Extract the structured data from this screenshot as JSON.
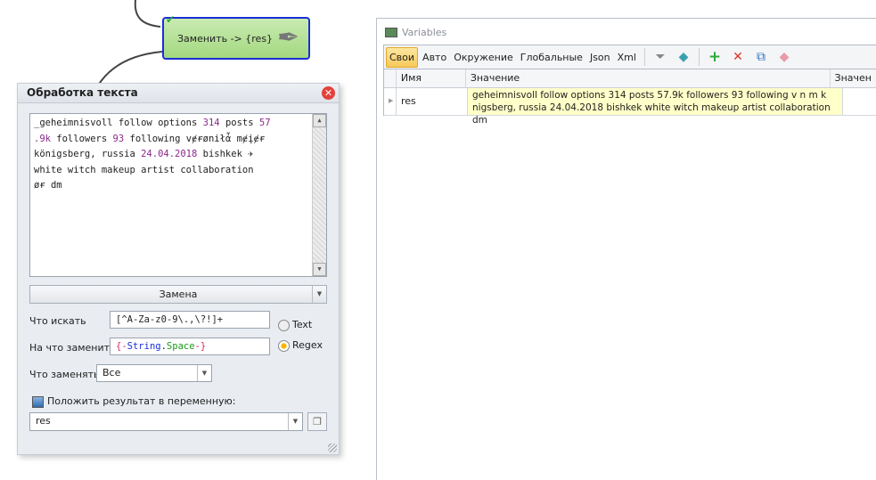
{
  "node": {
    "label": "Заменить -> {res}",
    "icon": "pen-nib-icon",
    "status": "check-icon"
  },
  "dialog": {
    "title": "Обработка текста",
    "text_lines": [
      [
        {
          "t": "_geheimnisvoll follow options "
        },
        {
          "t": "314",
          "n": 1
        },
        {
          "t": " posts "
        },
        {
          "t": "57",
          "n": 1
        }
      ],
      [
        {
          "t": ".9k",
          "n": 1
        },
        {
          "t": " followers "
        },
        {
          "t": "93",
          "n": 1
        },
        {
          "t": " following vɇɍøniłἆ mɇįɇɍ"
        }
      ],
      [
        {
          "t": "königsberg, russia "
        },
        {
          "t": "24.04.2018",
          "n": 1
        },
        {
          "t": " bishkek ✈"
        }
      ],
      [
        {
          "t": "white witch makeup artist collaboration"
        }
      ],
      [
        {
          "t": "øɍ dm"
        }
      ]
    ],
    "mode": "Замена",
    "search_label": "Что искать",
    "search_value": "[^A-Za-z0-9\\.,\\?!]+",
    "replace_label": "На что заменить",
    "replace_value": "{-String.Space-}",
    "radio_text": "Text",
    "radio_regex": "Regex",
    "radio_selected": "Regex",
    "which_label": "Что заменять",
    "which_value": "Все",
    "save_label": "Положить результат в переменную:",
    "save_var": "res"
  },
  "variables": {
    "title": "Variables",
    "tabs": [
      "Свои",
      "Авто",
      "Окружение",
      "Глобальные",
      "Json",
      "Xml"
    ],
    "active_tab": "Свои",
    "columns": [
      "Имя",
      "Значение",
      "Значен"
    ],
    "rows": [
      {
        "name": "res",
        "value": " geheimnisvoll follow options 314 posts 57.9k followers 93 following v n m k nigsberg, russia 24.04.2018 bishkek white witch makeup artist collaboration dm"
      }
    ]
  }
}
